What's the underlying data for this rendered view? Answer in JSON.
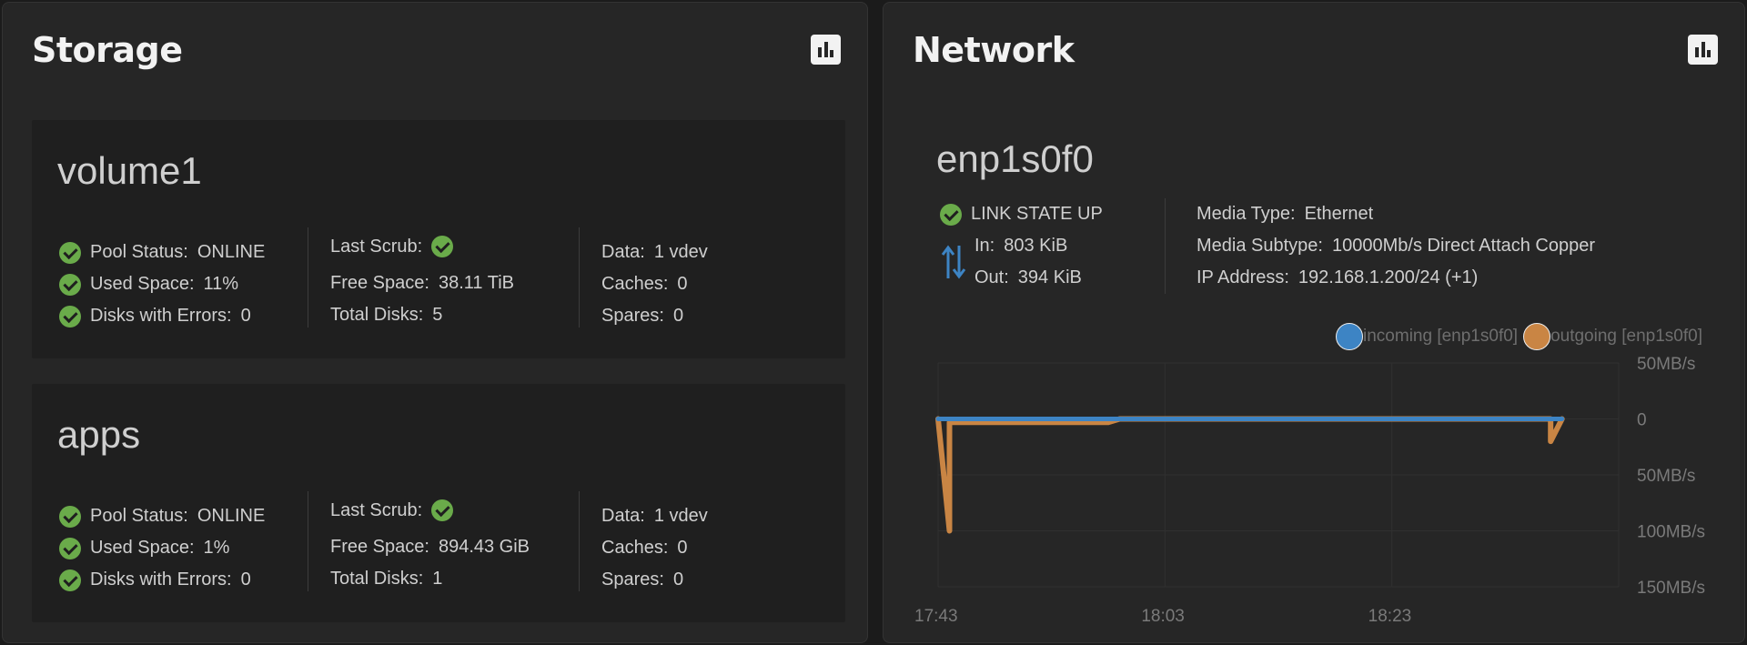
{
  "storage": {
    "title": "Storage",
    "pools": [
      {
        "name": "volume1",
        "pool_status_label": "Pool Status:",
        "pool_status": "ONLINE",
        "used_space_label": "Used Space:",
        "used_space": "11%",
        "disks_errors_label": "Disks with Errors:",
        "disks_errors": "0",
        "last_scrub_label": "Last Scrub:",
        "free_space_label": "Free Space:",
        "free_space": "38.11 TiB",
        "total_disks_label": "Total Disks:",
        "total_disks": "5",
        "data_label": "Data:",
        "data": "1 vdev",
        "caches_label": "Caches:",
        "caches": "0",
        "spares_label": "Spares:",
        "spares": "0"
      },
      {
        "name": "apps",
        "pool_status_label": "Pool Status:",
        "pool_status": "ONLINE",
        "used_space_label": "Used Space:",
        "used_space": "1%",
        "disks_errors_label": "Disks with Errors:",
        "disks_errors": "0",
        "last_scrub_label": "Last Scrub:",
        "free_space_label": "Free Space:",
        "free_space": "894.43 GiB",
        "total_disks_label": "Total Disks:",
        "total_disks": "1",
        "data_label": "Data:",
        "data": "1 vdev",
        "caches_label": "Caches:",
        "caches": "0",
        "spares_label": "Spares:",
        "spares": "0"
      }
    ]
  },
  "network": {
    "title": "Network",
    "interface": "enp1s0f0",
    "link_state": "LINK STATE UP",
    "in_label": "In:",
    "in_value": "803 KiB",
    "out_label": "Out:",
    "out_value": "394 KiB",
    "media_type_label": "Media Type:",
    "media_type": "Ethernet",
    "media_subtype_label": "Media Subtype:",
    "media_subtype": "10000Mb/s Direct Attach Copper",
    "ip_label": "IP Address:",
    "ip_value": "192.168.1.200/24 (+1)"
  },
  "colors": {
    "incoming": "#3d84c4",
    "outgoing": "#c98544",
    "ok": "#6aab4a"
  },
  "icons": [
    "chart-bar-icon",
    "check-circle-icon",
    "arrows-up-down-icon"
  ],
  "chart_data": {
    "type": "line",
    "series": [
      {
        "name": "incoming [enp1s0f0]",
        "color": "#3d84c4",
        "points": [
          [
            "17:43",
            0
          ],
          [
            "18:38",
            0
          ]
        ]
      },
      {
        "name": "outgoing [enp1s0f0]",
        "color": "#c98544",
        "points": [
          [
            "17:43",
            0
          ],
          [
            "17:44",
            -100
          ],
          [
            "17:44",
            -3
          ],
          [
            "17:58",
            -3
          ],
          [
            "17:59",
            0
          ],
          [
            "18:37",
            0
          ],
          [
            "18:37",
            -20
          ],
          [
            "18:38",
            0
          ]
        ]
      }
    ],
    "x_ticks": [
      "17:43",
      "18:03",
      "18:23"
    ],
    "x_range_minutes": [
      0,
      60
    ],
    "y_ticks": [
      "50MB/s",
      "0",
      "50MB/s",
      "100MB/s",
      "150MB/s"
    ],
    "y_tick_values": [
      50,
      0,
      -50,
      -100,
      -150
    ],
    "ylim": [
      -150,
      50
    ],
    "grid": true,
    "legend": "top-right"
  }
}
